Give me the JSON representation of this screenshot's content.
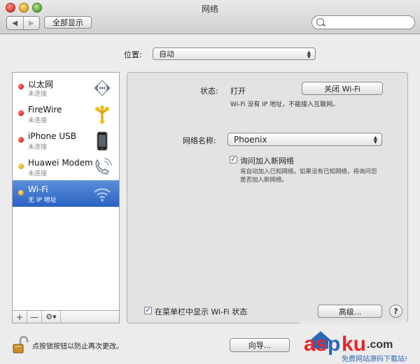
{
  "window": {
    "title": "网络"
  },
  "toolbar": {
    "back_glyph": "◀",
    "forward_glyph": "▶",
    "show_all_label": "全部显示",
    "search_placeholder": ""
  },
  "location": {
    "label": "位置:",
    "value": "自动"
  },
  "services": [
    {
      "name": "以太网",
      "status": "未连接",
      "dot": "red",
      "icon": "ethernet-icon",
      "selected": false
    },
    {
      "name": "FireWire",
      "status": "未连接",
      "dot": "red",
      "icon": "firewire-icon",
      "selected": false
    },
    {
      "name": "iPhone USB",
      "status": "未连接",
      "dot": "red",
      "icon": "iphone-icon",
      "selected": false
    },
    {
      "name": "Huawei Modem",
      "status": "未连接",
      "dot": "yellow",
      "icon": "modem-phone-icon",
      "selected": false
    },
    {
      "name": "Wi-Fi",
      "status": "无 IP 地址",
      "dot": "yellow",
      "icon": "wifi-icon",
      "selected": true
    }
  ],
  "sidebar_controls": {
    "add": "+",
    "remove": "—",
    "gear": "⚙▾"
  },
  "detail": {
    "status_label": "状态:",
    "status_value": "打开",
    "turn_off_button": "关闭 Wi-Fi",
    "status_description": "Wi-Fi 没有 IP 地址，不能接入互联网。",
    "network_name_label": "网络名称:",
    "network_name_value": "Phoenix",
    "ask_to_join_label": "询问加入新网络",
    "ask_to_join_checked": true,
    "ask_to_join_description": "将自动加入已知网络。如果没有已知网络，将询问您是否加入新网络。",
    "show_in_menu_label": "在菜单栏中显示 Wi-Fi 状态",
    "show_in_menu_checked": true,
    "advanced_button": "高级...",
    "help_button": "?"
  },
  "footer": {
    "lock_label": "点按锁按钮以防止再次更改。",
    "assist_button": "向导...",
    "watermark_text": "aspku",
    "watermark_subtext": "免费网站源码下载站!"
  },
  "colors": {
    "selection": "#2a62c2",
    "red_status": "#d21d10",
    "yellow_status": "#e0a010",
    "watermark_red": "#e8262c",
    "watermark_blue": "#2b67b3"
  }
}
